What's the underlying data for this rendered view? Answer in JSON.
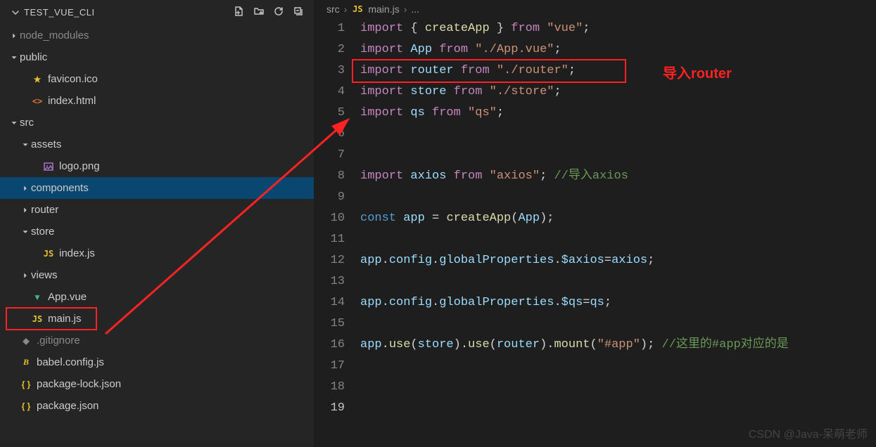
{
  "explorer": {
    "project_name": "TEST_VUE_CLI",
    "actions": [
      "new-file",
      "new-folder",
      "refresh",
      "collapse"
    ],
    "items": [
      {
        "depth": 0,
        "twisty": "right",
        "label": "node_modules",
        "icon": null,
        "grey": true
      },
      {
        "depth": 0,
        "twisty": "down",
        "label": "public",
        "icon": null
      },
      {
        "depth": 1,
        "twisty": null,
        "label": "favicon.ico",
        "icon": "star"
      },
      {
        "depth": 1,
        "twisty": null,
        "label": "index.html",
        "icon": "html"
      },
      {
        "depth": 0,
        "twisty": "down",
        "label": "src",
        "icon": null
      },
      {
        "depth": 1,
        "twisty": "down",
        "label": "assets",
        "icon": null
      },
      {
        "depth": 2,
        "twisty": null,
        "label": "logo.png",
        "icon": "img"
      },
      {
        "depth": 1,
        "twisty": "right",
        "label": "components",
        "icon": null,
        "selected": true
      },
      {
        "depth": 1,
        "twisty": "right",
        "label": "router",
        "icon": null
      },
      {
        "depth": 1,
        "twisty": "down",
        "label": "store",
        "icon": null
      },
      {
        "depth": 2,
        "twisty": null,
        "label": "index.js",
        "icon": "js"
      },
      {
        "depth": 1,
        "twisty": "right",
        "label": "views",
        "icon": null
      },
      {
        "depth": 1,
        "twisty": null,
        "label": "App.vue",
        "icon": "vue"
      },
      {
        "depth": 1,
        "twisty": null,
        "label": "main.js",
        "icon": "js",
        "boxed": true
      },
      {
        "depth": 0,
        "twisty": null,
        "label": ".gitignore",
        "icon": "git",
        "grey": true
      },
      {
        "depth": 0,
        "twisty": null,
        "label": "babel.config.js",
        "icon": "yellow"
      },
      {
        "depth": 0,
        "twisty": null,
        "label": "package-lock.json",
        "icon": "json"
      },
      {
        "depth": 0,
        "twisty": null,
        "label": "package.json",
        "icon": "json"
      }
    ]
  },
  "breadcrumb": {
    "parts": [
      "src",
      "main.js",
      "..."
    ],
    "file_icon": "js"
  },
  "code": {
    "lines": [
      [
        [
          "kw",
          "import"
        ],
        [
          "plain",
          " "
        ],
        [
          "punc",
          "{ "
        ],
        [
          "fn",
          "createApp"
        ],
        [
          "punc",
          " }"
        ],
        [
          "plain",
          " "
        ],
        [
          "kw",
          "from"
        ],
        [
          "plain",
          " "
        ],
        [
          "str",
          "\"vue\""
        ],
        [
          "punc",
          ";"
        ]
      ],
      [
        [
          "kw",
          "import"
        ],
        [
          "plain",
          " "
        ],
        [
          "id",
          "App"
        ],
        [
          "plain",
          " "
        ],
        [
          "kw",
          "from"
        ],
        [
          "plain",
          " "
        ],
        [
          "str",
          "\"./App.vue\""
        ],
        [
          "punc",
          ";"
        ]
      ],
      [
        [
          "kw",
          "import"
        ],
        [
          "plain",
          " "
        ],
        [
          "id",
          "router"
        ],
        [
          "plain",
          " "
        ],
        [
          "kw",
          "from"
        ],
        [
          "plain",
          " "
        ],
        [
          "str",
          "\"./router\""
        ],
        [
          "punc",
          ";"
        ]
      ],
      [
        [
          "kw",
          "import"
        ],
        [
          "plain",
          " "
        ],
        [
          "id",
          "store"
        ],
        [
          "plain",
          " "
        ],
        [
          "kw",
          "from"
        ],
        [
          "plain",
          " "
        ],
        [
          "str",
          "\"./store\""
        ],
        [
          "punc",
          ";"
        ]
      ],
      [
        [
          "kw",
          "import"
        ],
        [
          "plain",
          " "
        ],
        [
          "id",
          "qs"
        ],
        [
          "plain",
          " "
        ],
        [
          "kw",
          "from"
        ],
        [
          "plain",
          " "
        ],
        [
          "str",
          "\"qs\""
        ],
        [
          "punc",
          ";"
        ]
      ],
      [],
      [],
      [
        [
          "kw",
          "import"
        ],
        [
          "plain",
          " "
        ],
        [
          "id",
          "axios"
        ],
        [
          "plain",
          " "
        ],
        [
          "kw",
          "from"
        ],
        [
          "plain",
          " "
        ],
        [
          "str",
          "\"axios\""
        ],
        [
          "punc",
          "; "
        ],
        [
          "cmt",
          "//导入axios"
        ]
      ],
      [],
      [
        [
          "const",
          "const"
        ],
        [
          "plain",
          " "
        ],
        [
          "id",
          "app"
        ],
        [
          "plain",
          " "
        ],
        [
          "punc",
          "="
        ],
        [
          "plain",
          " "
        ],
        [
          "fn",
          "createApp"
        ],
        [
          "punc",
          "("
        ],
        [
          "id",
          "App"
        ],
        [
          "punc",
          ");"
        ]
      ],
      [],
      [
        [
          "id",
          "app"
        ],
        [
          "punc",
          "."
        ],
        [
          "id",
          "config"
        ],
        [
          "punc",
          "."
        ],
        [
          "id",
          "globalProperties"
        ],
        [
          "punc",
          "."
        ],
        [
          "id",
          "$axios"
        ],
        [
          "punc",
          "="
        ],
        [
          "id",
          "axios"
        ],
        [
          "punc",
          ";"
        ]
      ],
      [],
      [
        [
          "id",
          "app"
        ],
        [
          "punc",
          "."
        ],
        [
          "id",
          "config"
        ],
        [
          "punc",
          "."
        ],
        [
          "id",
          "globalProperties"
        ],
        [
          "punc",
          "."
        ],
        [
          "id",
          "$qs"
        ],
        [
          "punc",
          "="
        ],
        [
          "id",
          "qs"
        ],
        [
          "punc",
          ";"
        ]
      ],
      [],
      [
        [
          "id",
          "app"
        ],
        [
          "punc",
          "."
        ],
        [
          "fn",
          "use"
        ],
        [
          "punc",
          "("
        ],
        [
          "id",
          "store"
        ],
        [
          "punc",
          ")."
        ],
        [
          "fn",
          "use"
        ],
        [
          "punc",
          "("
        ],
        [
          "id",
          "router"
        ],
        [
          "punc",
          ")."
        ],
        [
          "fn",
          "mount"
        ],
        [
          "punc",
          "("
        ],
        [
          "str",
          "\"#app\""
        ],
        [
          "punc",
          "); "
        ],
        [
          "cmt",
          "//这里的#app对应的是"
        ]
      ],
      [],
      [],
      []
    ],
    "line_start": 1,
    "current_line": 19,
    "highlight_box_line": 3,
    "annotation_text": "导入router"
  },
  "watermark": "CSDN @Java-呆萌老师"
}
